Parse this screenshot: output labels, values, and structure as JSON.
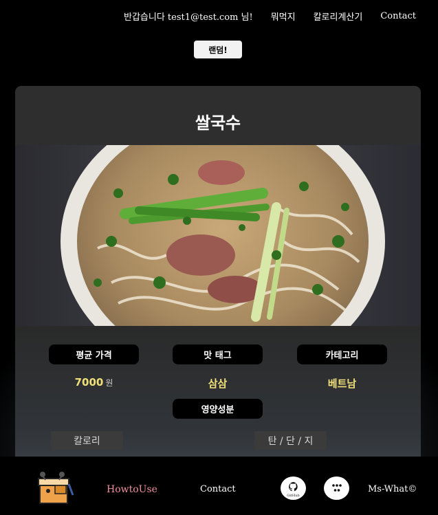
{
  "nav": {
    "greeting": "반갑습니다 test1@test.com 님!",
    "items": [
      "뭐먹지",
      "칼로리계산기",
      "Contact"
    ]
  },
  "random_button": "랜덤!",
  "food": {
    "name": "쌀국수",
    "image_alt": "pho-bowl",
    "price_label": "평균 가격",
    "price_value": "7000",
    "price_unit": "원",
    "taste_label": "맛 태그",
    "taste_value": "삼삼",
    "category_label": "카테고리",
    "category_value": "베트남",
    "nutrition_label": "영양성분",
    "calorie_tab": "칼로리",
    "macro_tab": "탄 / 단 / 지"
  },
  "footer": {
    "howto": "HowtoUse",
    "contact": "Contact",
    "github_label": "GitHub",
    "copyright": "Ms-What©"
  },
  "colors": {
    "accent_value": "#f1e07a",
    "howto": "#f08fa0",
    "card": "#2e2e2e"
  },
  "icons": {
    "logo": "box-character-logo-icon",
    "github": "github-icon",
    "more": "dots-menu-icon"
  }
}
